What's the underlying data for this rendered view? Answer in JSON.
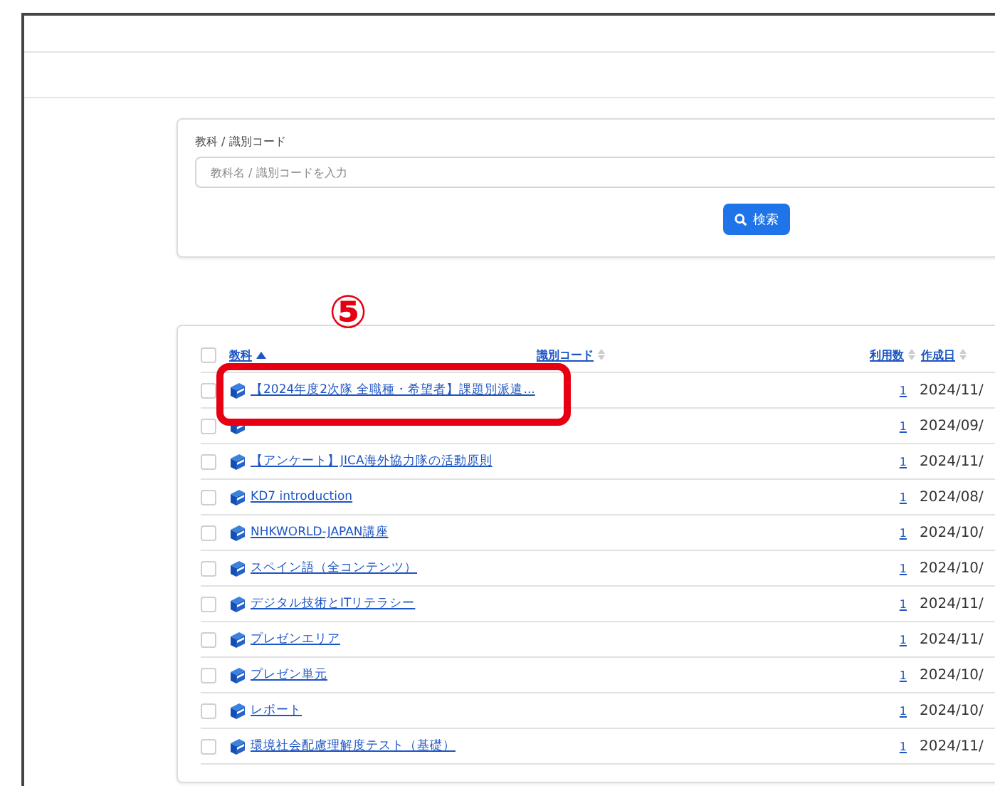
{
  "search": {
    "label": "教科 / 識別コード",
    "placeholder": "教科名 / 識別コードを入力",
    "button": "検索"
  },
  "annotation": {
    "label": "⑤"
  },
  "table": {
    "select_all_checked": false,
    "columns": [
      {
        "label": "教科",
        "sorted": true
      },
      {
        "label": "識別コード",
        "sorted": false
      },
      {
        "label": "利用数",
        "sorted": false
      },
      {
        "label": "作成日",
        "sorted": false
      }
    ],
    "rows": [
      {
        "checked": false,
        "title": "【2024年度2次隊 全職種・希望者】課題別派遣...",
        "count": "1",
        "created": "2024/11/"
      },
      {
        "checked": false,
        "count": "1",
        "created": "2024/09/"
      },
      {
        "checked": false,
        "title": "【アンケート】JICA海外協力隊の活動原則",
        "count": "1",
        "created": "2024/11/"
      },
      {
        "checked": false,
        "title": "KD7 introduction",
        "count": "1",
        "created": "2024/08/"
      },
      {
        "checked": false,
        "title": "NHKWORLD-JAPAN講座",
        "count": "1",
        "created": "2024/10/"
      },
      {
        "checked": false,
        "title": "スペイン語（全コンテンツ）",
        "count": "1",
        "created": "2024/10/"
      },
      {
        "checked": false,
        "title": "デジタル技術とITリテラシー",
        "count": "1",
        "created": "2024/11/"
      },
      {
        "checked": false,
        "title": "プレゼンエリア",
        "count": "1",
        "created": "2024/11/"
      },
      {
        "checked": false,
        "title": "プレゼン単元",
        "count": "1",
        "created": "2024/10/"
      },
      {
        "checked": false,
        "title": "レポート",
        "count": "1",
        "created": "2024/10/"
      },
      {
        "checked": false,
        "title": "環境社会配慮理解度テスト（基礎）",
        "count": "1",
        "created": "2024/11/"
      }
    ]
  }
}
